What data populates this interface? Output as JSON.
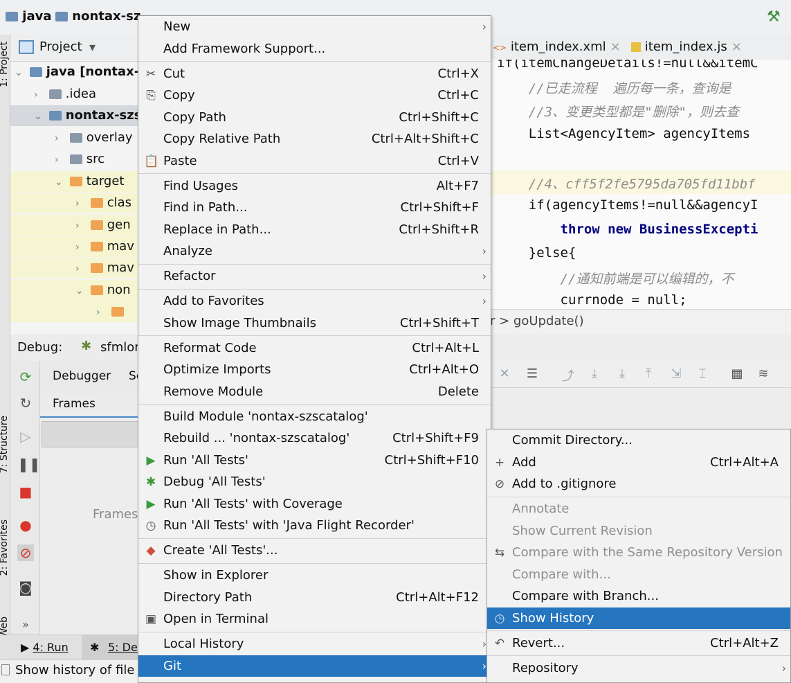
{
  "breadcrumb": {
    "root": "java",
    "module": "nontax-sz"
  },
  "project": {
    "tool_title": "Project",
    "side_label": "1: Project",
    "tree": [
      {
        "label": "java [nontax-c",
        "indent": 0
      },
      {
        "label": ".idea",
        "indent": 1
      },
      {
        "label": "nontax-szs",
        "indent": 1
      },
      {
        "label": "overlay",
        "indent": 2
      },
      {
        "label": "src",
        "indent": 2
      },
      {
        "label": "target",
        "indent": 2
      },
      {
        "label": "clas",
        "indent": 3
      },
      {
        "label": "gen",
        "indent": 3
      },
      {
        "label": "mav",
        "indent": 3
      },
      {
        "label": "mav",
        "indent": 3
      },
      {
        "label": "non",
        "indent": 3
      }
    ]
  },
  "editor": {
    "tabs": [
      {
        "label": "item_index.xml"
      },
      {
        "label": "item_index.js"
      }
    ],
    "lines": [
      "if(itemChangeDetails!=null&&itemC",
      "    //已走流程  遍历每一条，查询是",
      "    //3、变更类型都是\"删除\"，则去查",
      "    List<AgencyItem> agencyItems ",
      "",
      "    //4、cff5f2fe5795da705fd11bbf",
      "    if(agencyItems!=null&&agencyI",
      "        throw new BusinessExcepti",
      "    }else{",
      "        //通知前端是可以编辑的，不",
      "        currnode = null;"
    ],
    "status_path": "r  >  goUpdate()"
  },
  "debug": {
    "title": "Debug:",
    "config": "sfmlor",
    "tabs": [
      "Debugger",
      "Se"
    ],
    "frames_tab": "Frames",
    "frames_placeholder": "Frames"
  },
  "side_labels": {
    "structure": "7: Structure",
    "favorites": "2: Favorites",
    "web": "Web"
  },
  "bottom_tabs": [
    {
      "label": "4: Run"
    },
    {
      "label": "5: De"
    }
  ],
  "status_text": "Show history of file",
  "context_menu": {
    "items": [
      {
        "label": "New",
        "shortcut": "",
        "submenu": true,
        "icon": ""
      },
      {
        "label": "Add Framework Support...",
        "shortcut": "",
        "icon": ""
      },
      {
        "sep": true
      },
      {
        "label": "Cut",
        "shortcut": "Ctrl+X",
        "icon": "✂"
      },
      {
        "label": "Copy",
        "shortcut": "Ctrl+C",
        "icon": "⎘"
      },
      {
        "label": "Copy Path",
        "shortcut": "Ctrl+Shift+C",
        "icon": ""
      },
      {
        "label": "Copy Relative Path",
        "shortcut": "Ctrl+Alt+Shift+C",
        "icon": ""
      },
      {
        "label": "Paste",
        "shortcut": "Ctrl+V",
        "icon": "📋"
      },
      {
        "sep": true
      },
      {
        "label": "Find Usages",
        "shortcut": "Alt+F7",
        "icon": ""
      },
      {
        "label": "Find in Path...",
        "shortcut": "Ctrl+Shift+F",
        "icon": ""
      },
      {
        "label": "Replace in Path...",
        "shortcut": "Ctrl+Shift+R",
        "icon": ""
      },
      {
        "label": "Analyze",
        "shortcut": "",
        "submenu": true,
        "icon": ""
      },
      {
        "sep": true
      },
      {
        "label": "Refactor",
        "shortcut": "",
        "submenu": true,
        "icon": ""
      },
      {
        "sep": true
      },
      {
        "label": "Add to Favorites",
        "shortcut": "",
        "submenu": true,
        "icon": ""
      },
      {
        "label": "Show Image Thumbnails",
        "shortcut": "Ctrl+Shift+T",
        "icon": ""
      },
      {
        "sep": true
      },
      {
        "label": "Reformat Code",
        "shortcut": "Ctrl+Alt+L",
        "icon": ""
      },
      {
        "label": "Optimize Imports",
        "shortcut": "Ctrl+Alt+O",
        "icon": ""
      },
      {
        "label": "Remove Module",
        "shortcut": "Delete",
        "icon": ""
      },
      {
        "sep": true
      },
      {
        "label": "Build Module 'nontax-szscatalog'",
        "shortcut": "",
        "icon": ""
      },
      {
        "label": "Rebuild ... 'nontax-szscatalog'",
        "shortcut": "Ctrl+Shift+F9",
        "icon": ""
      },
      {
        "label": "Run 'All Tests'",
        "shortcut": "Ctrl+Shift+F10",
        "icon": "▶"
      },
      {
        "label": "Debug 'All Tests'",
        "shortcut": "",
        "icon": "✱"
      },
      {
        "label": "Run 'All Tests' with Coverage",
        "shortcut": "",
        "icon": "▶"
      },
      {
        "label": "Run 'All Tests' with 'Java Flight Recorder'",
        "shortcut": "",
        "icon": "◷"
      },
      {
        "sep": true
      },
      {
        "label": "Create 'All Tests'...",
        "shortcut": "",
        "icon": "◆"
      },
      {
        "sep": true
      },
      {
        "label": "Show in Explorer",
        "shortcut": "",
        "icon": ""
      },
      {
        "label": "Directory Path",
        "shortcut": "Ctrl+Alt+F12",
        "icon": ""
      },
      {
        "label": "Open in Terminal",
        "shortcut": "",
        "icon": "▣"
      },
      {
        "sep": true
      },
      {
        "label": "Local History",
        "shortcut": "",
        "submenu": true,
        "icon": ""
      },
      {
        "label": "Git",
        "shortcut": "",
        "submenu": true,
        "icon": "",
        "selected": true
      }
    ]
  },
  "git_menu": {
    "items": [
      {
        "label": "Commit Directory...",
        "shortcut": "",
        "icon": ""
      },
      {
        "label": "Add",
        "shortcut": "Ctrl+Alt+A",
        "icon": "+"
      },
      {
        "label": "Add to .gitignore",
        "shortcut": "",
        "icon": "⊘"
      },
      {
        "sep": true
      },
      {
        "label": "Annotate",
        "shortcut": "",
        "icon": "",
        "disabled": true
      },
      {
        "label": "Show Current Revision",
        "shortcut": "",
        "icon": "",
        "disabled": true
      },
      {
        "label": "Compare with the Same Repository Version",
        "shortcut": "",
        "icon": "⇆",
        "disabled": true
      },
      {
        "label": "Compare with...",
        "shortcut": "",
        "icon": "",
        "disabled": true
      },
      {
        "label": "Compare with Branch...",
        "shortcut": "",
        "icon": ""
      },
      {
        "label": "Show History",
        "shortcut": "",
        "icon": "◷",
        "selected": true
      },
      {
        "sep": true
      },
      {
        "label": "Revert...",
        "shortcut": "Ctrl+Alt+Z",
        "icon": "↶"
      },
      {
        "sep": true
      },
      {
        "label": "Repository",
        "shortcut": "",
        "submenu": true,
        "icon": ""
      }
    ]
  },
  "colors": {
    "selection": "#2675bf",
    "menu_bg": "#f2f2f2",
    "folder": "#f0a350"
  }
}
